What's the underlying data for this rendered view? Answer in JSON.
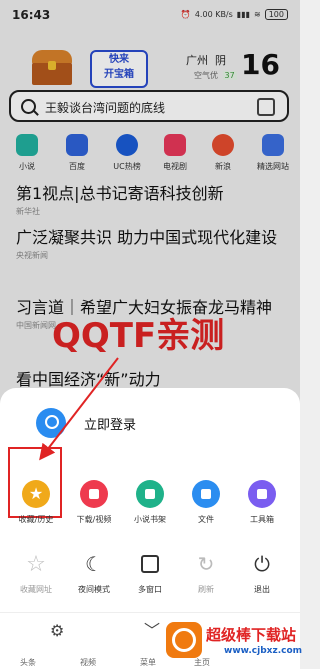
{
  "status": {
    "time": "16:43",
    "net_speed": "4.00\nKB/s",
    "battery": "100"
  },
  "promo": {
    "line1": "快来",
    "line2": "开宝箱"
  },
  "weather": {
    "city": "广州",
    "condition": "阴",
    "aqi_label": "空气优",
    "aqi_value": "37",
    "temperature": "16"
  },
  "search": {
    "placeholder": "王毅谈台湾问题的底线"
  },
  "quick_links": [
    {
      "label": "小说",
      "color": "#22b0a0"
    },
    {
      "label": "百度",
      "color": "#2e63d8"
    },
    {
      "label": "UC热榜",
      "color": "#1a5cd6"
    },
    {
      "label": "电视剧",
      "color": "#e8375a"
    },
    {
      "label": "新浪",
      "color": "#e64c2e"
    },
    {
      "label": "精选网站",
      "color": "#3b6fe0"
    }
  ],
  "news": [
    {
      "headline": "第1视点|总书记寄语科技创新",
      "source": "新华社"
    },
    {
      "headline": "广泛凝聚共识 助力中国式现代化建设",
      "source": "央视新闻"
    },
    {
      "headline": "习言道｜希望广大妇女振奋龙马精神",
      "source": "中国新闻网"
    },
    {
      "headline": "看中国经济“新”动力",
      "source": ""
    }
  ],
  "watermark": "QQTF亲测",
  "sheet": {
    "login_label": "立即登录",
    "row1": [
      {
        "label": "收藏/历史",
        "icon": "star-icon",
        "color": "#f0a91a"
      },
      {
        "label": "下载/视频",
        "icon": "download-icon",
        "color": "#ee3a4e"
      },
      {
        "label": "小说书架",
        "icon": "book-icon",
        "color": "#1fb28a"
      },
      {
        "label": "文件",
        "icon": "folder-icon",
        "color": "#2b8df0"
      },
      {
        "label": "工具箱",
        "icon": "toolbox-icon",
        "color": "#7a5df0"
      }
    ],
    "row2": [
      {
        "label": "收藏网址",
        "icon": "star-add-icon"
      },
      {
        "label": "夜间模式",
        "icon": "moon-icon"
      },
      {
        "label": "多窗口",
        "icon": "window-icon"
      },
      {
        "label": "刷新",
        "icon": "refresh-icon"
      },
      {
        "label": "退出",
        "icon": "power-icon"
      }
    ]
  },
  "nav": [
    "头条",
    "视频",
    "菜单",
    "主页"
  ],
  "logo": {
    "title": "超级棒下载站",
    "url": "www.cjbxz.com"
  }
}
